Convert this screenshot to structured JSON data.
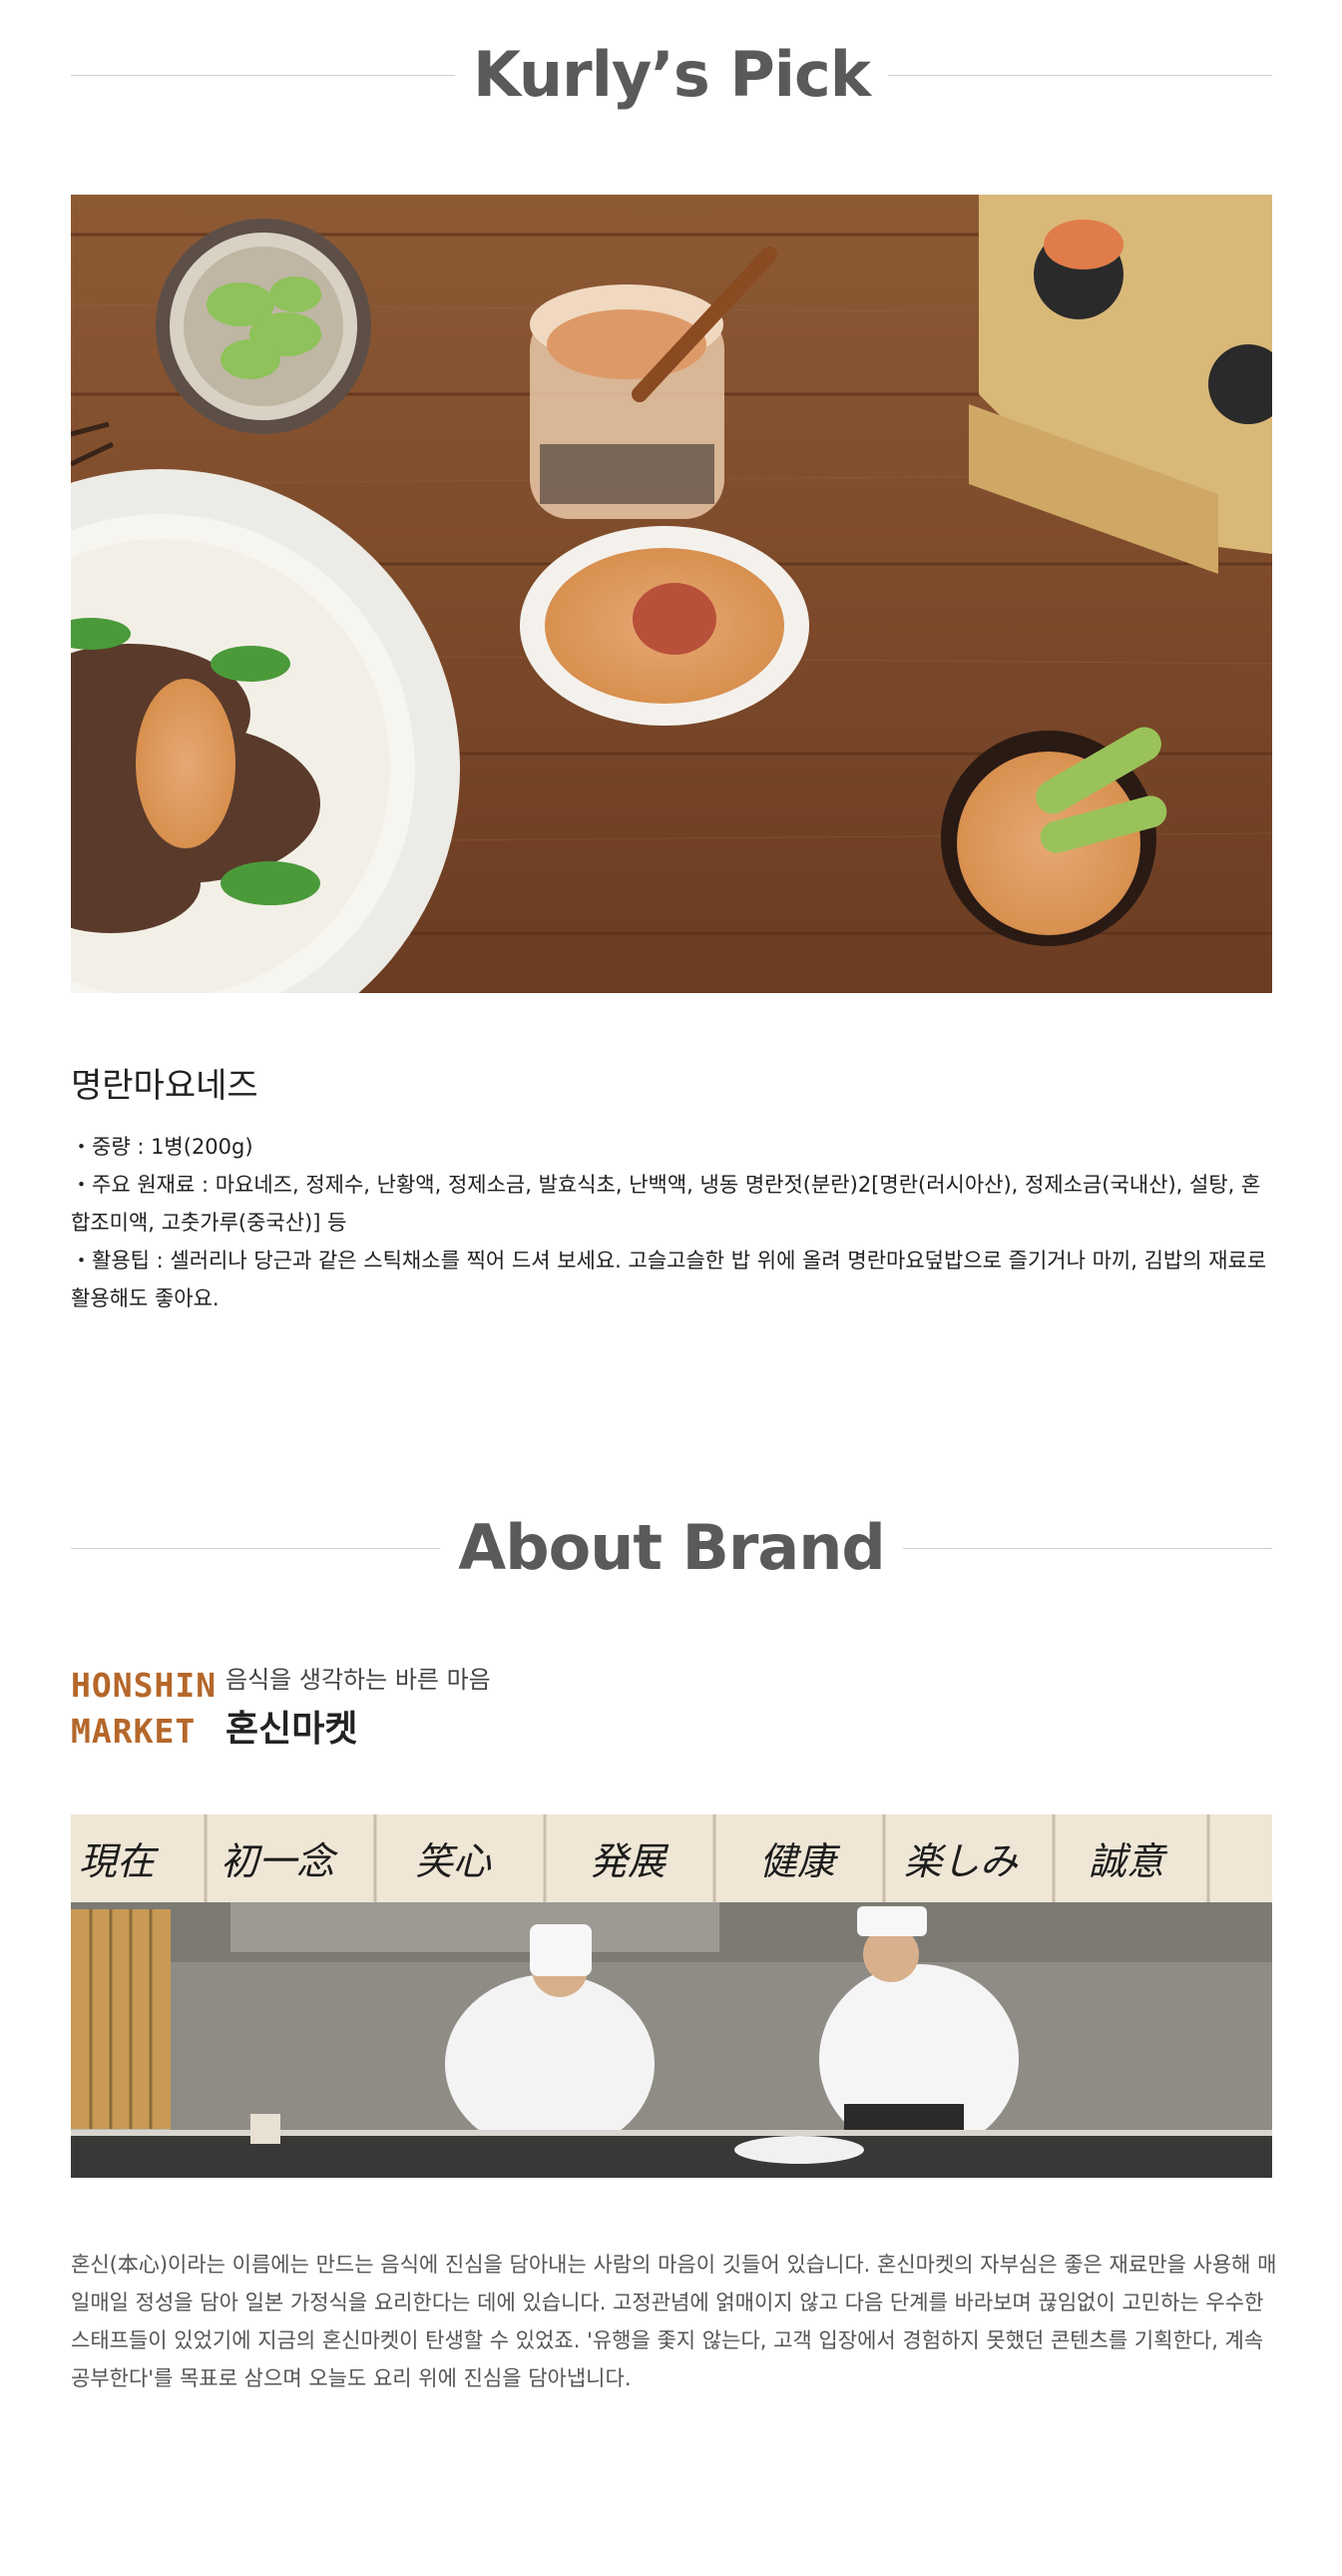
{
  "kurlys_pick": {
    "title": "Kurly’s Pick",
    "product_name": "명란마요네즈",
    "details": [
      "・중량 : 1병(200g)",
      "・주요 원재료 : 마요네즈, 정제수, 난황액, 정제소금, 발효식초, 난백액, 냉동 명란젓(분란)2[명란(러시아산), 정제소금(국내산), 설탕, 혼합조미액, 고춧가루(중국산)] 등",
      "・활용팁 : 셀러리나 당근과 같은 스틱채소를 찍어 드셔 보세요. 고슬고슬한 밥 위에 올려 명란마요덮밥으로 즐기거나 마끼, 김밥의 재료로 활용해도 좋아요."
    ]
  },
  "about_brand": {
    "title": "About Brand",
    "logo_line1": "HONSHIN",
    "logo_line2": "MARKET",
    "subtitle": "음식을 생각하는 바른 마음",
    "brand_name": "혼신마켓",
    "noren_labels": [
      "現在",
      "初一念",
      "笑心",
      "発展",
      "健康",
      "楽しみ",
      "誠意"
    ],
    "description": "혼신(本心)이라는 이름에는 만드는 음식에 진심을 담아내는 사람의 마음이 깃들어 있습니다. 혼신마켓의 자부심은 좋은 재료만을 사용해 매일매일 정성을 담아 일본 가정식을 요리한다는 데에 있습니다. 고정관념에 얽매이지 않고 다음 단계를 바라보며 끊임없이 고민하는 우수한 스태프들이 있었기에 지금의 혼신마켓이 탄생할 수 있었죠. '유행을 좇지 않는다, 고객 입장에서 경험하지 못했던 콘텐츠를 기획한다, 계속 공부한다'를 목표로 삼으며 오늘도 요리 위에 진심을 담아냅니다."
  },
  "colors": {
    "title_gray": "#5a5a5a",
    "brand_orange": "#b5672a",
    "divider": "#cfcfcf"
  }
}
